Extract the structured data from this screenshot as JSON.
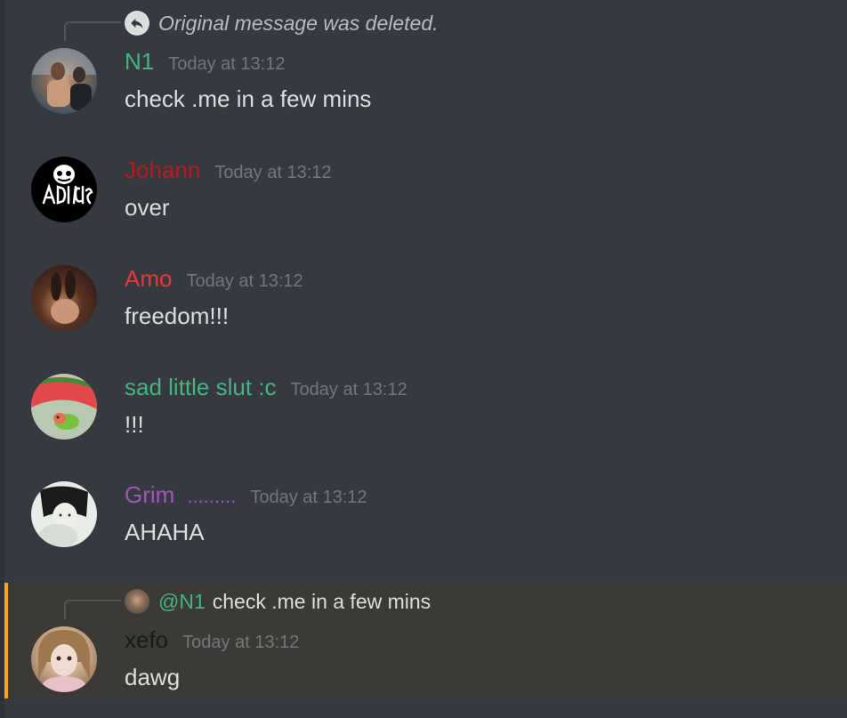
{
  "reply_deleted": {
    "text": "Original message was deleted."
  },
  "messages": [
    {
      "username": "N1",
      "username_color": "#43b581",
      "timestamp": "Today at 13:12",
      "content": "check .me in a few mins"
    },
    {
      "username": "Johann",
      "username_color": "#b71c1c",
      "timestamp": "Today at 13:12",
      "content": "over"
    },
    {
      "username": "Amo",
      "username_color": "#e53935",
      "timestamp": "Today at 13:12",
      "content": "freedom!!!"
    },
    {
      "username": "sad little slut :c",
      "username_color": "#43b581",
      "timestamp": "Today at 13:12",
      "content": "!!!"
    },
    {
      "username": "Grim",
      "tag": ".........",
      "username_color": "#9b59b6",
      "timestamp": "Today at 13:12",
      "content": "AHAHA"
    },
    {
      "username": "xefo",
      "username_color": "#1a1a1a",
      "timestamp": "Today at 13:12",
      "content": "dawg",
      "reply": {
        "mention": "@N1",
        "text": "check .me in a few mins"
      }
    }
  ],
  "colors": {
    "background": "#36393f",
    "highlight_bar": "#faa61a",
    "highlight_bg": "#3c3a36",
    "timestamp": "#72767d",
    "text": "#dcddde"
  }
}
